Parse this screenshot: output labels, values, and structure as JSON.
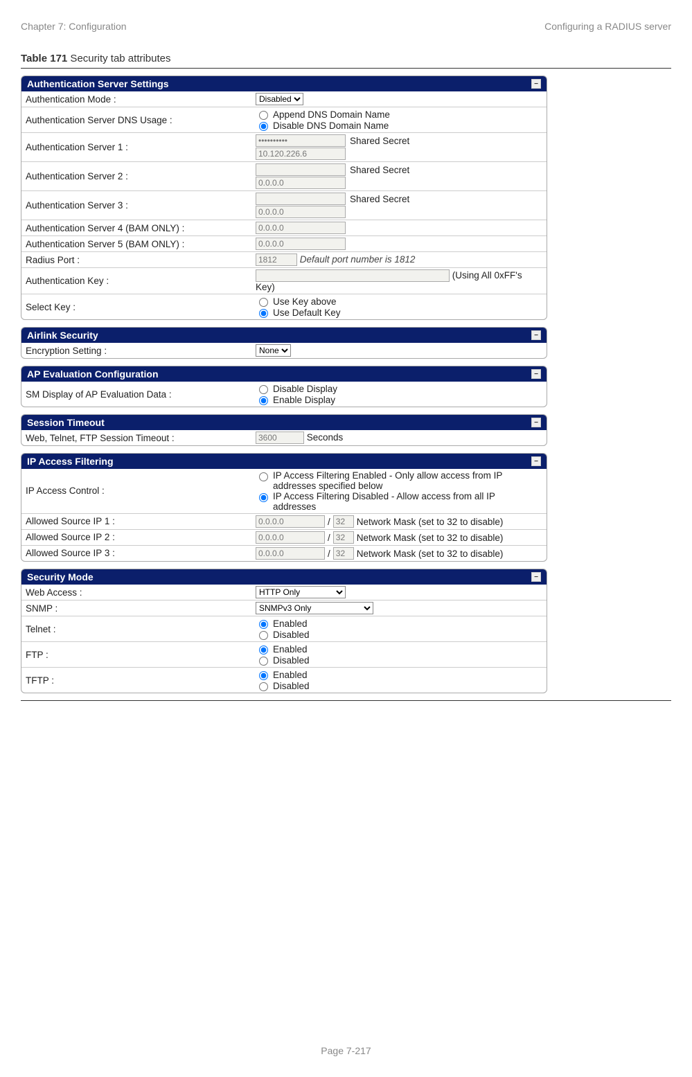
{
  "header": {
    "left": "Chapter 7:  Configuration",
    "right": "Configuring a RADIUS server"
  },
  "table_title_bold": "Table 171",
  "table_title_rest": " Security tab attributes",
  "footer": "Page 7-217",
  "sections": {
    "auth": {
      "title": "Authentication Server Settings",
      "mode_label": "Authentication Mode :",
      "mode_value": "Disabled",
      "dns_label": "Authentication Server DNS Usage :",
      "dns_opt1": "Append DNS Domain Name",
      "dns_opt2": "Disable DNS Domain Name",
      "s1_label": "Authentication Server 1 :",
      "s1_secret_label": "Shared Secret",
      "s1_secret_value": "••••••••••",
      "s1_ip": "10.120.226.6",
      "s2_label": "Authentication Server 2 :",
      "s2_secret_label": "Shared Secret",
      "s2_ip": "0.0.0.0",
      "s3_label": "Authentication Server 3 :",
      "s3_secret_label": "Shared Secret",
      "s3_ip": "0.0.0.0",
      "s4_label": "Authentication Server 4 (BAM ONLY) :",
      "s4_ip": "0.0.0.0",
      "s5_label": "Authentication Server 5 (BAM ONLY) :",
      "s5_ip": "0.0.0.0",
      "radius_label": "Radius Port :",
      "radius_value": "1812",
      "radius_note": "Default port number is 1812",
      "key_label": "Authentication Key :",
      "key_note": "(Using All 0xFF's Key)",
      "select_key_label": "Select Key :",
      "select_key_opt1": "Use Key above",
      "select_key_opt2": "Use Default Key"
    },
    "airlink": {
      "title": "Airlink Security",
      "enc_label": "Encryption Setting :",
      "enc_value": "None"
    },
    "apeval": {
      "title": "AP Evaluation Configuration",
      "label": "SM Display of AP Evaluation Data :",
      "opt1": "Disable Display",
      "opt2": "Enable Display"
    },
    "session": {
      "title": "Session Timeout",
      "label": "Web, Telnet, FTP Session Timeout :",
      "value": "3600",
      "unit": "Seconds"
    },
    "ipfilter": {
      "title": "IP Access Filtering",
      "control_label": "IP Access Control :",
      "opt1": "IP Access Filtering Enabled - Only allow access from IP addresses specified below",
      "opt2": "IP Access Filtering Disabled - Allow access from all IP addresses",
      "src1_label": "Allowed Source IP 1 :",
      "src2_label": "Allowed Source IP 2 :",
      "src3_label": "Allowed Source IP 3 :",
      "src_ip": "0.0.0.0",
      "mask": "32",
      "mask_note": "Network Mask (set to 32 to disable)"
    },
    "secmode": {
      "title": "Security Mode",
      "web_label": "Web Access :",
      "web_value": "HTTP Only",
      "snmp_label": "SNMP :",
      "snmp_value": "SNMPv3 Only",
      "telnet_label": "Telnet :",
      "ftp_label": "FTP :",
      "tftp_label": "TFTP :",
      "enabled": "Enabled",
      "disabled": "Disabled"
    }
  }
}
